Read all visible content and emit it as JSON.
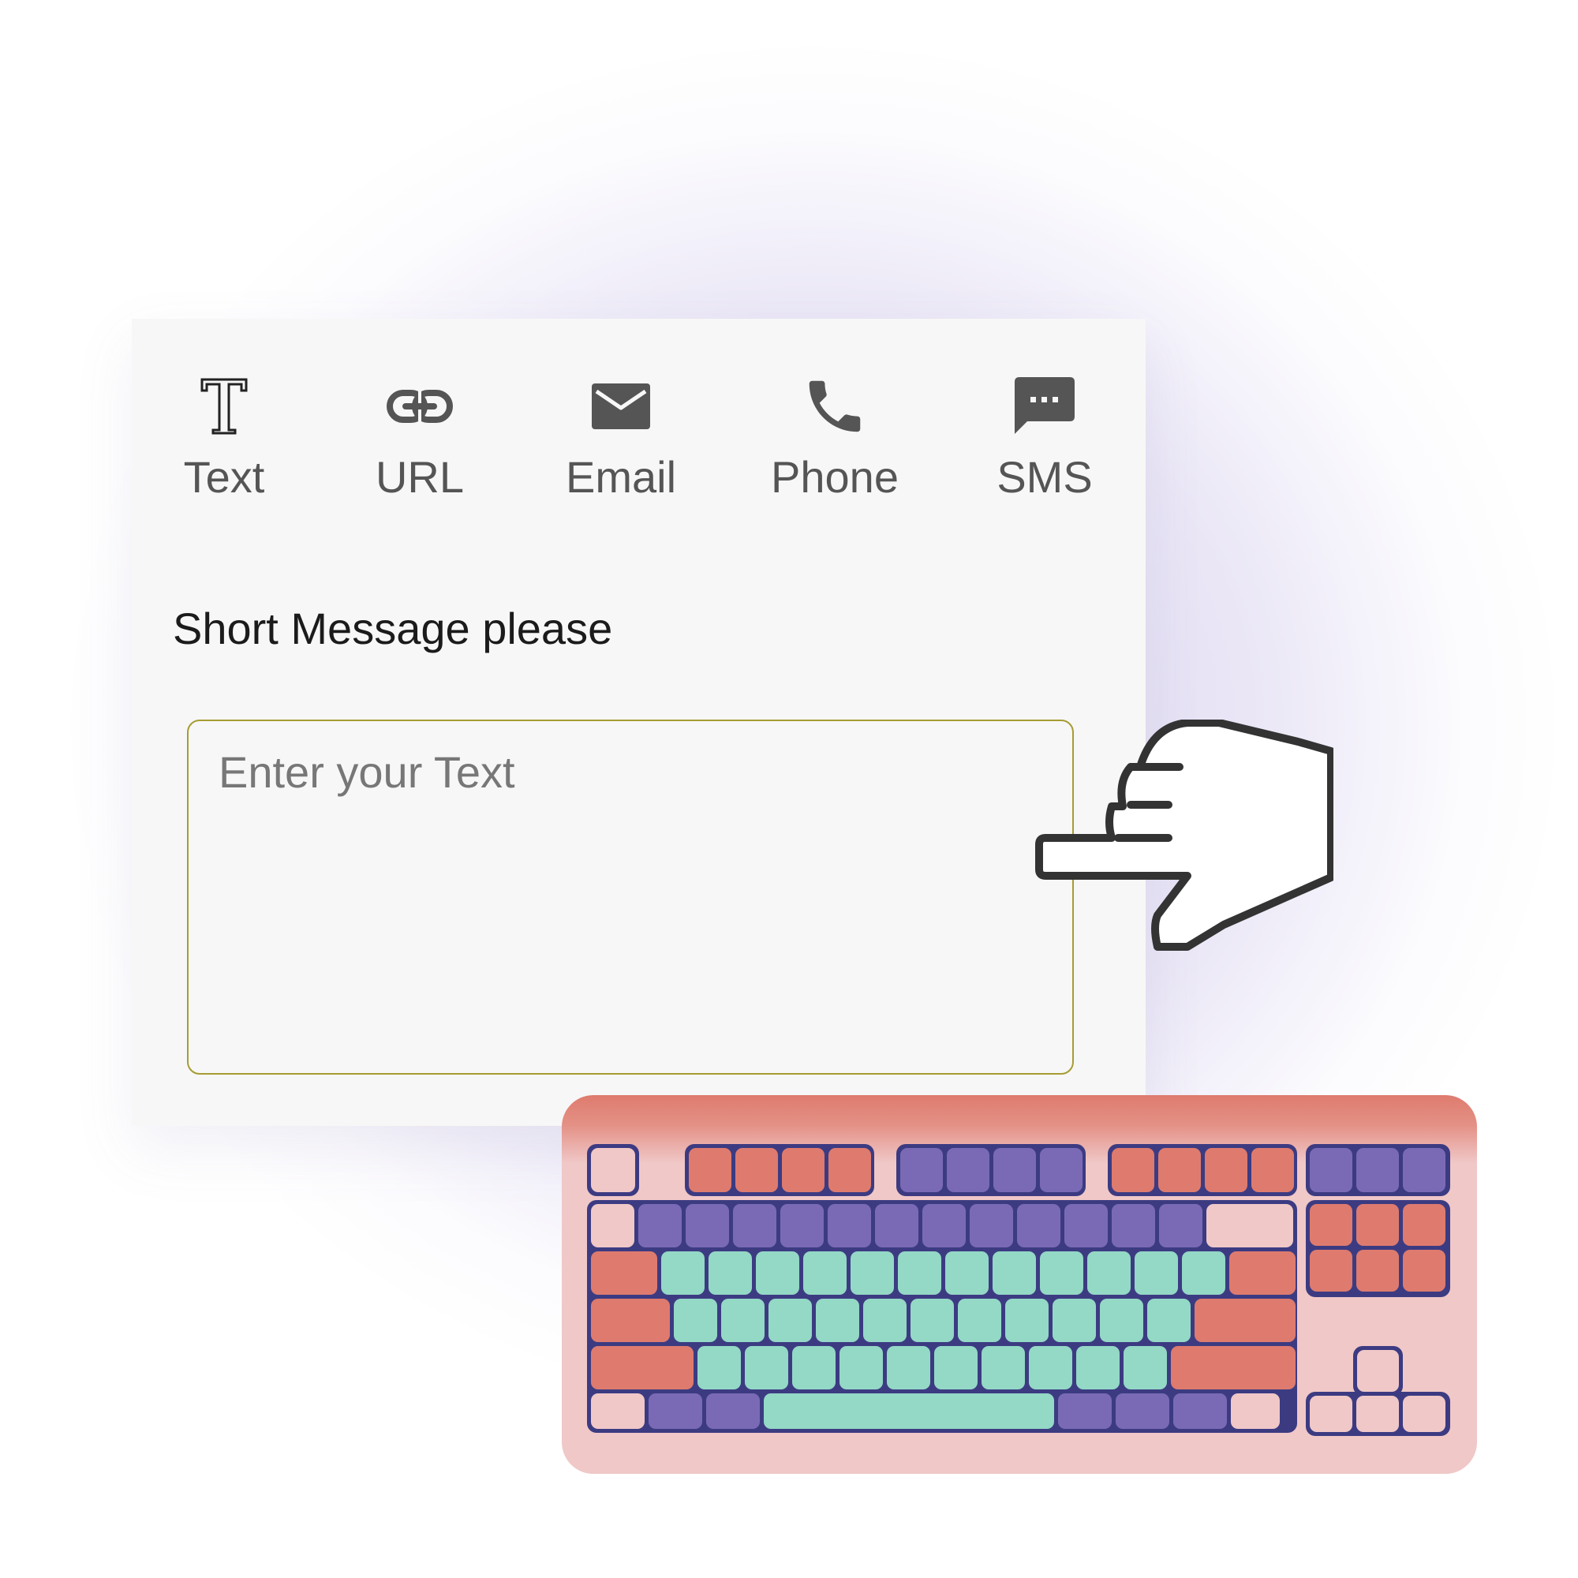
{
  "tabs": [
    {
      "id": "text",
      "label": "Text",
      "icon": "text-format-icon"
    },
    {
      "id": "url",
      "label": "URL",
      "icon": "link-icon"
    },
    {
      "id": "email",
      "label": "Email",
      "icon": "mail-icon"
    },
    {
      "id": "phone",
      "label": "Phone",
      "icon": "phone-icon"
    },
    {
      "id": "sms",
      "label": "SMS",
      "icon": "sms-chat-icon"
    }
  ],
  "form": {
    "title": "Short Message please",
    "message_value": "",
    "message_placeholder": "Enter your Text"
  },
  "illustrations": {
    "hand": "pointing-hand-icon",
    "keyboard": "keyboard-illustration"
  },
  "colors": {
    "input_border": "#a69c33",
    "icon": "#555555",
    "keyboard_body": "#f0c8c8",
    "keyboard_red": "#de7b6e",
    "keyboard_purple": "#7a6ab6",
    "keyboard_teal": "#94d8c6",
    "keyboard_outline": "#3c3b82"
  }
}
